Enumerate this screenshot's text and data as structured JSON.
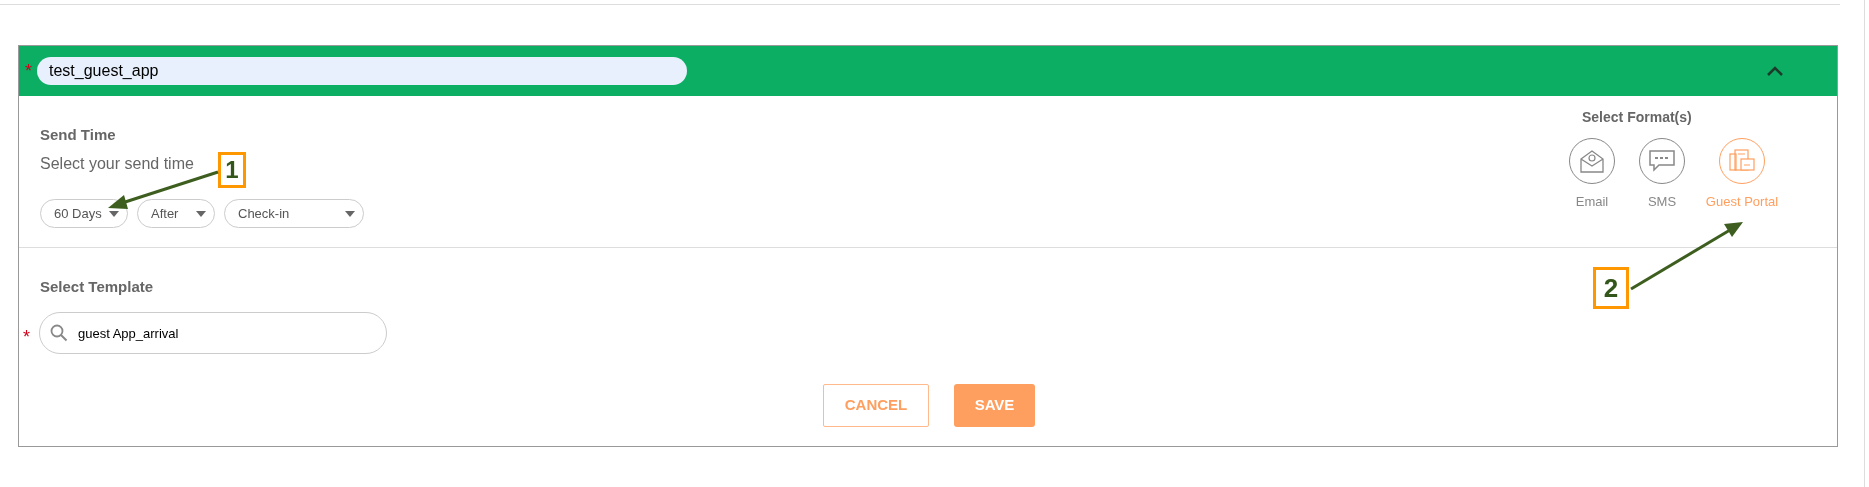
{
  "section": {
    "name": "test_guest_app",
    "required_mark": "*",
    "expanded": true
  },
  "send_time": {
    "title": "Send Time",
    "subtitle": "Select your send time",
    "dropdowns": [
      {
        "value": "60 Days"
      },
      {
        "value": "After"
      },
      {
        "value": "Check-in"
      }
    ]
  },
  "formats": {
    "title": "Select Format(s)",
    "items": [
      {
        "kind": "email",
        "label": "Email",
        "selected": false
      },
      {
        "kind": "sms",
        "label": "SMS",
        "selected": false
      },
      {
        "kind": "portal",
        "label": "Guest Portal",
        "selected": true
      }
    ]
  },
  "template": {
    "title": "Select Template",
    "value": "guest App_arrival",
    "required_mark": "*"
  },
  "buttons": {
    "cancel": "CANCEL",
    "save": "SAVE"
  },
  "callouts": [
    {
      "label": "1"
    },
    {
      "label": "2"
    }
  ]
}
